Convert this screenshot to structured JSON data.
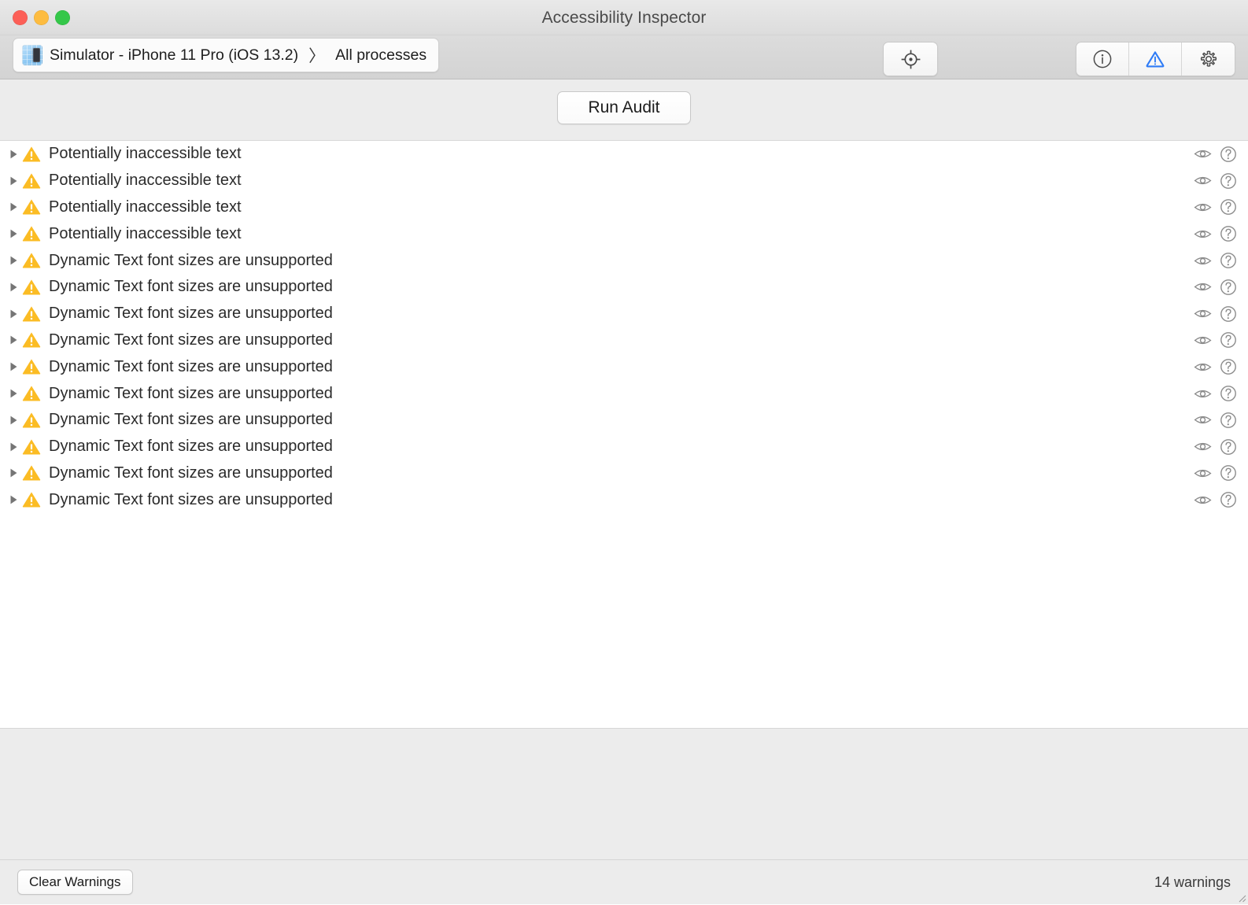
{
  "window": {
    "title": "Accessibility Inspector",
    "traffic_lights": [
      {
        "name": "close-button",
        "color": "#fc5f57"
      },
      {
        "name": "minimize-button",
        "color": "#fdbc40"
      },
      {
        "name": "maximize-button",
        "color": "#34c749"
      }
    ]
  },
  "toolbar": {
    "target": {
      "icon": "simulator-app-icon",
      "process": "Simulator - iPhone 11 Pro (iOS 13.2)",
      "separator": "〉",
      "scope": "All processes"
    },
    "inspect_button": {
      "icon": "crosshair-target-icon",
      "label": ""
    },
    "segments": [
      {
        "icon": "info-circle-icon",
        "name": "inspection-tab",
        "selected": false
      },
      {
        "icon": "warning-triangle-icon",
        "name": "audit-tab",
        "selected": true
      },
      {
        "icon": "gear-icon",
        "name": "settings-tab",
        "selected": false
      }
    ],
    "selected_color": "#2f7cf6",
    "icon_color": "#4a4a4a"
  },
  "audit": {
    "run_button_label": "Run Audit"
  },
  "list": {
    "row_action_icons": [
      "eye-icon",
      "help-circle-icon"
    ],
    "warning_color": "#fbbc24",
    "disclosure_color": "#757575",
    "rows": [
      {
        "label": "Potentially inaccessible text"
      },
      {
        "label": "Potentially inaccessible text"
      },
      {
        "label": "Potentially inaccessible text"
      },
      {
        "label": "Potentially inaccessible text"
      },
      {
        "label": "Dynamic Text font sizes are unsupported"
      },
      {
        "label": "Dynamic Text font sizes are unsupported"
      },
      {
        "label": "Dynamic Text font sizes are unsupported"
      },
      {
        "label": "Dynamic Text font sizes are unsupported"
      },
      {
        "label": "Dynamic Text font sizes are unsupported"
      },
      {
        "label": "Dynamic Text font sizes are unsupported"
      },
      {
        "label": "Dynamic Text font sizes are unsupported"
      },
      {
        "label": "Dynamic Text font sizes are unsupported"
      },
      {
        "label": "Dynamic Text font sizes are unsupported"
      },
      {
        "label": "Dynamic Text font sizes are unsupported"
      }
    ]
  },
  "statusbar": {
    "clear_button_label": "Clear Warnings",
    "count_label": "14 warnings"
  }
}
